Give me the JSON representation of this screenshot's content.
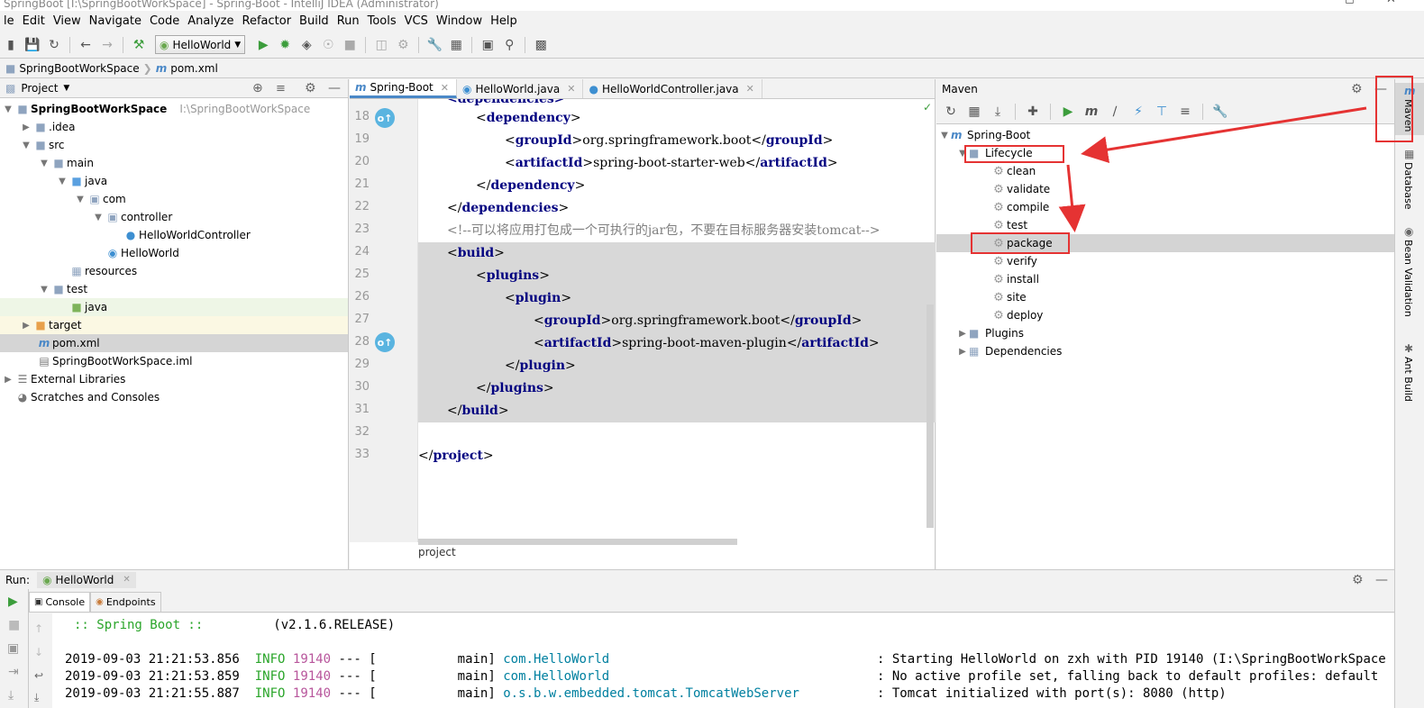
{
  "window": {
    "title": "SpringBoot [I:\\SpringBootWorkSpace] - Spring-Boot - IntelliJ IDEA (Administrator)"
  },
  "menu": [
    "le",
    "Edit",
    "View",
    "Navigate",
    "Code",
    "Analyze",
    "Refactor",
    "Build",
    "Run",
    "Tools",
    "VCS",
    "Window",
    "Help"
  ],
  "toolbar": {
    "run_config": "HelloWorld"
  },
  "navbar": {
    "root": "SpringBootWorkSpace",
    "file": "pom.xml"
  },
  "project": {
    "title": "Project",
    "tree": [
      {
        "label": "SpringBootWorkSpace",
        "hint": "I:\\SpringBootWorkSpace"
      },
      {
        "label": ".idea"
      },
      {
        "label": "src"
      },
      {
        "label": "main"
      },
      {
        "label": "java"
      },
      {
        "label": "com"
      },
      {
        "label": "controller"
      },
      {
        "label": "HelloWorldController"
      },
      {
        "label": "HelloWorld"
      },
      {
        "label": "resources"
      },
      {
        "label": "test"
      },
      {
        "label": "java"
      },
      {
        "label": "target"
      },
      {
        "label": "pom.xml"
      },
      {
        "label": "SpringBootWorkSpace.iml"
      },
      {
        "label": "External Libraries"
      },
      {
        "label": "Scratches and Consoles"
      }
    ]
  },
  "editor": {
    "tabs": [
      {
        "label": "Spring-Boot"
      },
      {
        "label": "HelloWorld.java"
      },
      {
        "label": "HelloWorldController.java"
      }
    ],
    "line_numbers": [
      "18",
      "19",
      "20",
      "21",
      "22",
      "23",
      "24",
      "25",
      "26",
      "27",
      "28",
      "29",
      "30",
      "31",
      "32",
      "33"
    ],
    "lines": {
      "l18": {
        "open": "dependency"
      },
      "l19": {
        "tag": "groupId",
        "text": "org.springframework.boot"
      },
      "l20": {
        "tag": "artifactId",
        "text": "spring-boot-starter-web"
      },
      "l21": {
        "close": "dependency"
      },
      "l22": {
        "close": "dependencies"
      },
      "l23": {
        "comment": "<!--可以将应用打包成一个可执行的jar包，不要在目标服务器安装tomcat-->"
      },
      "l24": {
        "open": "build"
      },
      "l25": {
        "open": "plugins"
      },
      "l26": {
        "open": "plugin"
      },
      "l27": {
        "tag": "groupId",
        "text": "org.springframework.boot"
      },
      "l28": {
        "tag": "artifactId",
        "text": "spring-boot-maven-plugin"
      },
      "l29": {
        "close": "plugin"
      },
      "l30": {
        "close": "plugins"
      },
      "l31": {
        "close": "build"
      },
      "l33": {
        "close": "project"
      }
    },
    "breadcrumb": "project"
  },
  "maven": {
    "title": "Maven",
    "project": "Spring-Boot",
    "lifecycle_label": "Lifecycle",
    "goals": [
      "clean",
      "validate",
      "compile",
      "test",
      "package",
      "verify",
      "install",
      "site",
      "deploy"
    ],
    "plugins_label": "Plugins",
    "dependencies_label": "Dependencies"
  },
  "right_strip": [
    "Maven",
    "Database",
    "Bean Validation",
    "Ant Build"
  ],
  "run": {
    "label": "Run:",
    "config": "HelloWorld",
    "tabs": [
      "Console",
      "Endpoints"
    ],
    "banner_left": ":: Spring Boot ::",
    "banner_right": "(v2.1.6.RELEASE)",
    "logs": [
      {
        "ts": "2019-09-03 21:21:53.856",
        "level": "INFO",
        "pid": "19140",
        "sep": "--- [",
        "thread": "main]",
        "logger": "com.HelloWorld",
        "msg": ": Starting HelloWorld on zxh with PID 19140 (I:\\SpringBootWorkSpace"
      },
      {
        "ts": "2019-09-03 21:21:53.859",
        "level": "INFO",
        "pid": "19140",
        "sep": "--- [",
        "thread": "main]",
        "logger": "com.HelloWorld",
        "msg": ": No active profile set, falling back to default profiles: default"
      },
      {
        "ts": "2019-09-03 21:21:55.887",
        "level": "INFO",
        "pid": "19140",
        "sep": "--- [",
        "thread": "main]",
        "logger": "o.s.b.w.embedded.tomcat.TomcatWebServer",
        "msg": ": Tomcat initialized with port(s): 8080 (http)"
      }
    ]
  },
  "colors": {
    "annotation_red": "#e53333",
    "accent": "#4a88c7"
  }
}
